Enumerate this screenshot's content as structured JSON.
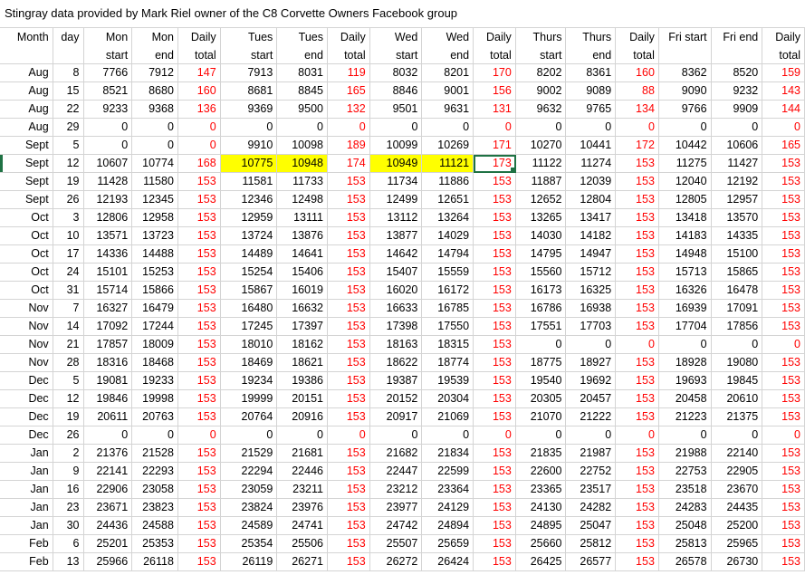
{
  "sheet": {
    "title": "Stingray data provided by Mark Riel owner of the C8 Corvette Owners Facebook group",
    "headers": [
      [
        "Month",
        ""
      ],
      [
        "day",
        ""
      ],
      [
        "Mon",
        "start"
      ],
      [
        "Mon",
        "end"
      ],
      [
        "Daily",
        "total"
      ],
      [
        "Tues",
        "start"
      ],
      [
        "Tues",
        "end"
      ],
      [
        "Daily",
        "total"
      ],
      [
        "Wed",
        "start"
      ],
      [
        "Wed",
        "end"
      ],
      [
        "Daily",
        "total"
      ],
      [
        "Thurs",
        "start"
      ],
      [
        "Thurs",
        "end"
      ],
      [
        "Daily",
        "total"
      ],
      [
        "Fri start",
        ""
      ],
      [
        "Fri end",
        ""
      ],
      [
        "Daily",
        "total"
      ]
    ],
    "rows": [
      [
        "Aug",
        "8",
        "7766",
        "7912",
        "147",
        "7913",
        "8031",
        "119",
        "8032",
        "8201",
        "170",
        "8202",
        "8361",
        "160",
        "8362",
        "8520",
        "159"
      ],
      [
        "Aug",
        "15",
        "8521",
        "8680",
        "160",
        "8681",
        "8845",
        "165",
        "8846",
        "9001",
        "156",
        "9002",
        "9089",
        "88",
        "9090",
        "9232",
        "143"
      ],
      [
        "Aug",
        "22",
        "9233",
        "9368",
        "136",
        "9369",
        "9500",
        "132",
        "9501",
        "9631",
        "131",
        "9632",
        "9765",
        "134",
        "9766",
        "9909",
        "144"
      ],
      [
        "Aug",
        "29",
        "0",
        "0",
        "0",
        "0",
        "0",
        "0",
        "0",
        "0",
        "0",
        "0",
        "0",
        "0",
        "0",
        "0",
        "0"
      ],
      [
        "Sept",
        "5",
        "0",
        "0",
        "0",
        "9910",
        "10098",
        "189",
        "10099",
        "10269",
        "171",
        "10270",
        "10441",
        "172",
        "10442",
        "10606",
        "165"
      ],
      [
        "Sept",
        "12",
        "10607",
        "10774",
        "168",
        "10775",
        "10948",
        "174",
        "10949",
        "11121",
        "173",
        "11122",
        "11274",
        "153",
        "11275",
        "11427",
        "153"
      ],
      [
        "Sept",
        "19",
        "11428",
        "11580",
        "153",
        "11581",
        "11733",
        "153",
        "11734",
        "11886",
        "153",
        "11887",
        "12039",
        "153",
        "12040",
        "12192",
        "153"
      ],
      [
        "Sept",
        "26",
        "12193",
        "12345",
        "153",
        "12346",
        "12498",
        "153",
        "12499",
        "12651",
        "153",
        "12652",
        "12804",
        "153",
        "12805",
        "12957",
        "153"
      ],
      [
        "Oct",
        "3",
        "12806",
        "12958",
        "153",
        "12959",
        "13111",
        "153",
        "13112",
        "13264",
        "153",
        "13265",
        "13417",
        "153",
        "13418",
        "13570",
        "153"
      ],
      [
        "Oct",
        "10",
        "13571",
        "13723",
        "153",
        "13724",
        "13876",
        "153",
        "13877",
        "14029",
        "153",
        "14030",
        "14182",
        "153",
        "14183",
        "14335",
        "153"
      ],
      [
        "Oct",
        "17",
        "14336",
        "14488",
        "153",
        "14489",
        "14641",
        "153",
        "14642",
        "14794",
        "153",
        "14795",
        "14947",
        "153",
        "14948",
        "15100",
        "153"
      ],
      [
        "Oct",
        "24",
        "15101",
        "15253",
        "153",
        "15254",
        "15406",
        "153",
        "15407",
        "15559",
        "153",
        "15560",
        "15712",
        "153",
        "15713",
        "15865",
        "153"
      ],
      [
        "Oct",
        "31",
        "15714",
        "15866",
        "153",
        "15867",
        "16019",
        "153",
        "16020",
        "16172",
        "153",
        "16173",
        "16325",
        "153",
        "16326",
        "16478",
        "153"
      ],
      [
        "Nov",
        "7",
        "16327",
        "16479",
        "153",
        "16480",
        "16632",
        "153",
        "16633",
        "16785",
        "153",
        "16786",
        "16938",
        "153",
        "16939",
        "17091",
        "153"
      ],
      [
        "Nov",
        "14",
        "17092",
        "17244",
        "153",
        "17245",
        "17397",
        "153",
        "17398",
        "17550",
        "153",
        "17551",
        "17703",
        "153",
        "17704",
        "17856",
        "153"
      ],
      [
        "Nov",
        "21",
        "17857",
        "18009",
        "153",
        "18010",
        "18162",
        "153",
        "18163",
        "18315",
        "153",
        "0",
        "0",
        "0",
        "0",
        "0",
        "0"
      ],
      [
        "Nov",
        "28",
        "18316",
        "18468",
        "153",
        "18469",
        "18621",
        "153",
        "18622",
        "18774",
        "153",
        "18775",
        "18927",
        "153",
        "18928",
        "19080",
        "153"
      ],
      [
        "Dec",
        "5",
        "19081",
        "19233",
        "153",
        "19234",
        "19386",
        "153",
        "19387",
        "19539",
        "153",
        "19540",
        "19692",
        "153",
        "19693",
        "19845",
        "153"
      ],
      [
        "Dec",
        "12",
        "19846",
        "19998",
        "153",
        "19999",
        "20151",
        "153",
        "20152",
        "20304",
        "153",
        "20305",
        "20457",
        "153",
        "20458",
        "20610",
        "153"
      ],
      [
        "Dec",
        "19",
        "20611",
        "20763",
        "153",
        "20764",
        "20916",
        "153",
        "20917",
        "21069",
        "153",
        "21070",
        "21222",
        "153",
        "21223",
        "21375",
        "153"
      ],
      [
        "Dec",
        "26",
        "0",
        "0",
        "0",
        "0",
        "0",
        "0",
        "0",
        "0",
        "0",
        "0",
        "0",
        "0",
        "0",
        "0",
        "0"
      ],
      [
        "Jan",
        "2",
        "21376",
        "21528",
        "153",
        "21529",
        "21681",
        "153",
        "21682",
        "21834",
        "153",
        "21835",
        "21987",
        "153",
        "21988",
        "22140",
        "153"
      ],
      [
        "Jan",
        "9",
        "22141",
        "22293",
        "153",
        "22294",
        "22446",
        "153",
        "22447",
        "22599",
        "153",
        "22600",
        "22752",
        "153",
        "22753",
        "22905",
        "153"
      ],
      [
        "Jan",
        "16",
        "22906",
        "23058",
        "153",
        "23059",
        "23211",
        "153",
        "23212",
        "23364",
        "153",
        "23365",
        "23517",
        "153",
        "23518",
        "23670",
        "153"
      ],
      [
        "Jan",
        "23",
        "23671",
        "23823",
        "153",
        "23824",
        "23976",
        "153",
        "23977",
        "24129",
        "153",
        "24130",
        "24282",
        "153",
        "24283",
        "24435",
        "153"
      ],
      [
        "Jan",
        "30",
        "24436",
        "24588",
        "153",
        "24589",
        "24741",
        "153",
        "24742",
        "24894",
        "153",
        "24895",
        "25047",
        "153",
        "25048",
        "25200",
        "153"
      ],
      [
        "Feb",
        "6",
        "25201",
        "25353",
        "153",
        "25354",
        "25506",
        "153",
        "25507",
        "25659",
        "153",
        "25660",
        "25812",
        "153",
        "25813",
        "25965",
        "153"
      ],
      [
        "Feb",
        "13",
        "25966",
        "26118",
        "153",
        "26119",
        "26271",
        "153",
        "26272",
        "26424",
        "153",
        "26425",
        "26577",
        "153",
        "26578",
        "26730",
        "153"
      ]
    ],
    "highlighted_cells": [
      [
        5,
        5
      ],
      [
        5,
        6
      ],
      [
        5,
        8
      ],
      [
        5,
        9
      ]
    ],
    "selected_cell": [
      5,
      10
    ],
    "colors": {
      "daily_total_text": "#ff0000",
      "highlight_fill": "#ffff00",
      "selection_border": "#1f7244",
      "gridline": "#d4d4d4"
    }
  }
}
